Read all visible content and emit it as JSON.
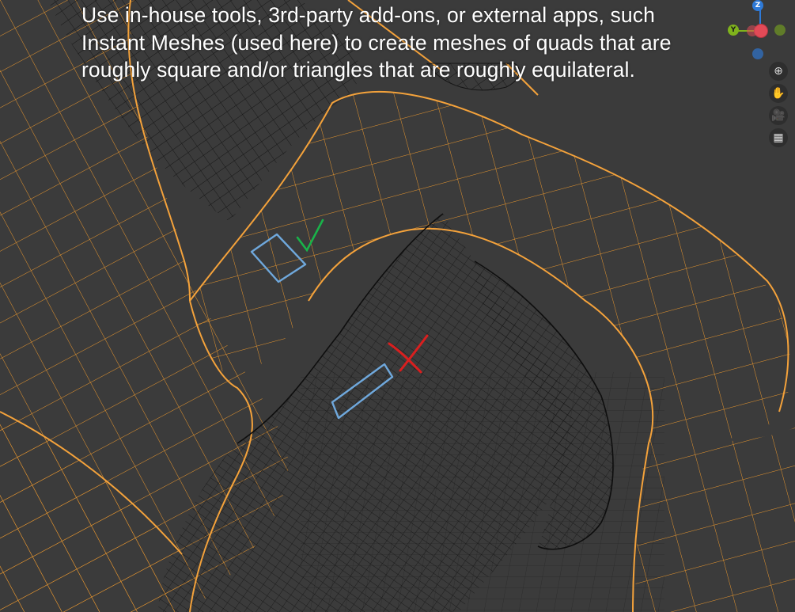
{
  "caption": {
    "line1": "Use in-house tools, 3rd-party add-ons, or external apps, such",
    "line2": "Instant Meshes (used here) to create meshes of quads that are",
    "line3": "roughly square and/or triangles that are roughly equilateral."
  },
  "gizmo": {
    "z_label": "Z",
    "y_label": "Y",
    "x_color": "#e24a57",
    "y_color": "#7fb31c",
    "z_color": "#2e7ad8"
  },
  "tools": [
    {
      "name": "zoom-icon",
      "glyph": "⊕"
    },
    {
      "name": "hand-icon",
      "glyph": "✋"
    },
    {
      "name": "camera-icon",
      "glyph": "🎥"
    },
    {
      "name": "grid-view-icon",
      "glyph": "▦"
    }
  ],
  "colors": {
    "background": "#3b3b3b",
    "mesh_gray": "#111111",
    "mesh_orange": "#e8962e",
    "annotation_blue": "#6fa8dc",
    "check_green": "#19b34a",
    "cross_red": "#d91f1f"
  },
  "annotations": {
    "good_mark": "✓",
    "bad_mark": "✗"
  }
}
